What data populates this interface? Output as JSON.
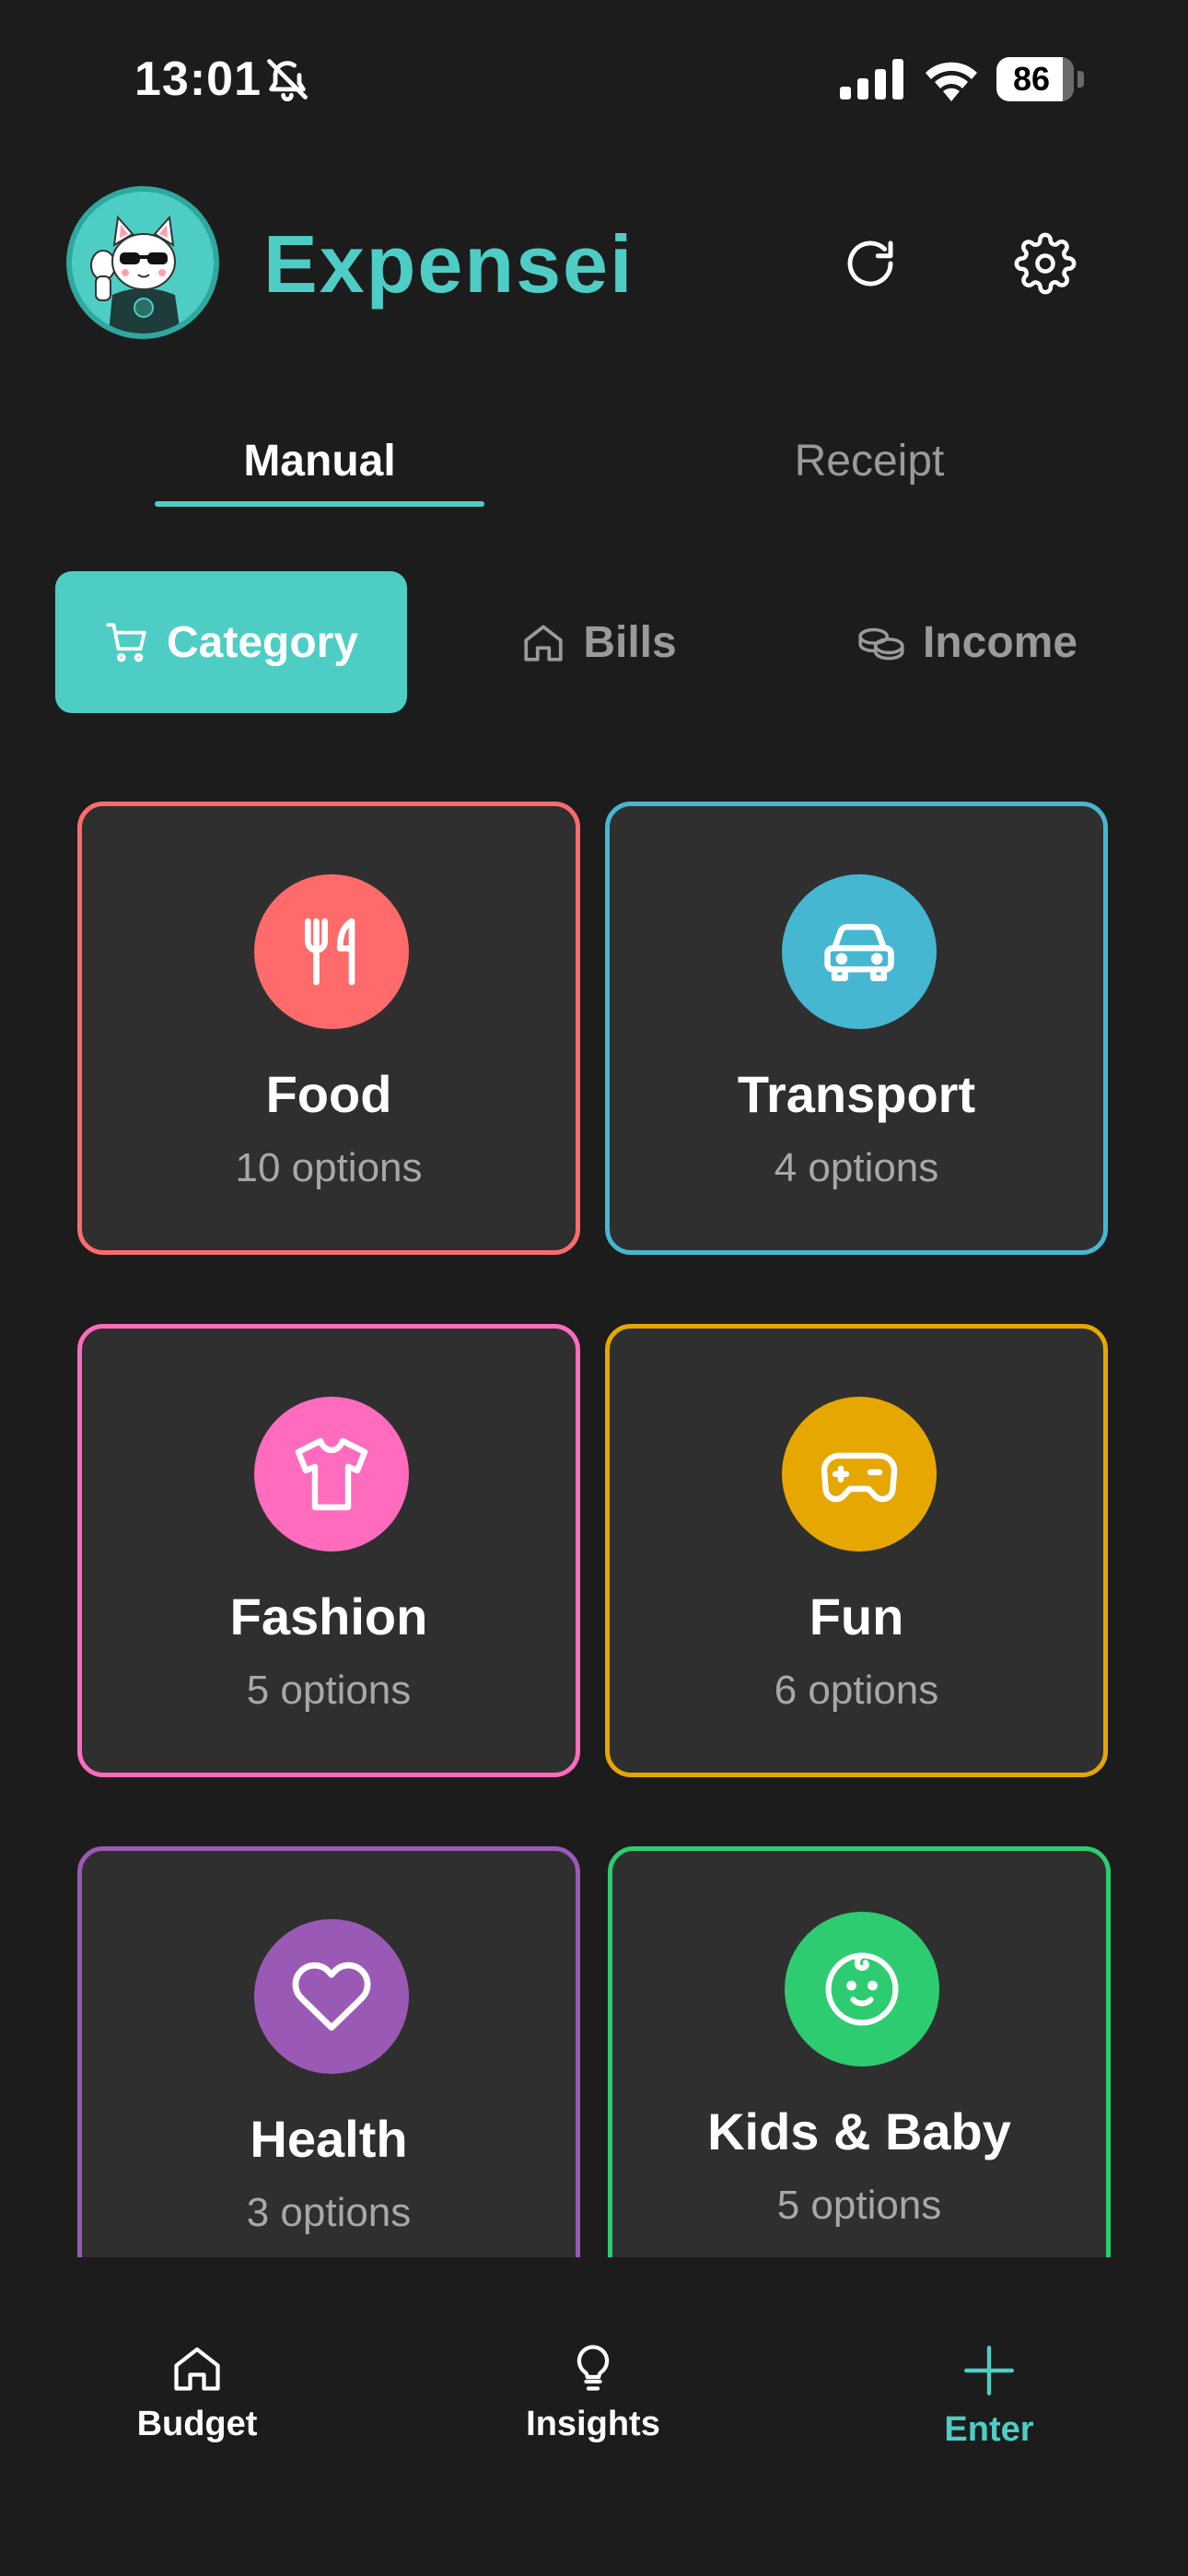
{
  "status_bar": {
    "time": "13:01",
    "battery": "86",
    "battery_level": 0.86
  },
  "header": {
    "title": "Expensei",
    "avatar_icon": "lucky-cat-avatar",
    "refresh_icon": "refresh-icon",
    "settings_icon": "gear-icon"
  },
  "mode_tabs": [
    {
      "label": "Manual",
      "active": true
    },
    {
      "label": "Receipt",
      "active": false
    }
  ],
  "segments": [
    {
      "label": "Category",
      "icon": "cart-icon",
      "active": true
    },
    {
      "label": "Bills",
      "icon": "home-icon",
      "active": false
    },
    {
      "label": "Income",
      "icon": "coins-icon",
      "active": false
    }
  ],
  "categories": [
    {
      "name": "Food",
      "count": "10 options",
      "color": "#ff6b6b",
      "icon": "fork-knife-icon"
    },
    {
      "name": "Transport",
      "count": "4 options",
      "color": "#45b7d1",
      "icon": "car-icon"
    },
    {
      "name": "Fashion",
      "count": "5 options",
      "color": "#ff6bbd",
      "icon": "shirt-icon"
    },
    {
      "name": "Fun",
      "count": "6 options",
      "color": "#e6a700",
      "icon": "gamepad-icon"
    },
    {
      "name": "Health",
      "count": "3 options",
      "color": "#9b59b6",
      "icon": "heart-icon"
    },
    {
      "name": "Kids & Baby",
      "count": "5 options",
      "color": "#2ecc71",
      "icon": "baby-icon"
    }
  ],
  "bottom_nav": [
    {
      "label": "Budget",
      "icon": "home-icon",
      "active": false
    },
    {
      "label": "Insights",
      "icon": "lightbulb-icon",
      "active": false
    },
    {
      "label": "Enter",
      "icon": "plus-icon",
      "active": true
    }
  ],
  "colors": {
    "accent": "#4ecdc4",
    "background": "#1c1c1c",
    "card": "#2f2f2f",
    "muted": "#9a9a9a"
  }
}
